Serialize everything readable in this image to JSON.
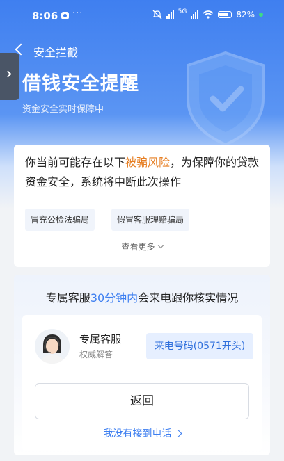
{
  "status_bar": {
    "time": "8:06",
    "more": "···",
    "network": "5G",
    "battery": "82%"
  },
  "nav": {
    "back_title": "安全拦截"
  },
  "header": {
    "title": "借钱安全提醒",
    "subtitle": "资金安全实时保障中"
  },
  "warning": {
    "text_before": "你当前可能存在以下",
    "highlight": "被骗风险",
    "text_after": "，为保障你的贷款资金安全，系统将中断此次操作",
    "tags": [
      "冒充公检法骗局",
      "假冒客服理赔骗局"
    ],
    "more_label": "查看更多"
  },
  "service": {
    "headline_before": "专属客服",
    "headline_highlight": "30分钟内",
    "headline_after": "会来电跟你核实情况",
    "agent_name": "专属客服",
    "agent_role": "权威解答",
    "phone_label": "来电号码(0571开头)",
    "return_label": "返回",
    "no_call_label": "我没有接到电话"
  },
  "colors": {
    "primary": "#3f7ff0",
    "highlight": "#e67e22",
    "link": "#3c7ef0"
  }
}
